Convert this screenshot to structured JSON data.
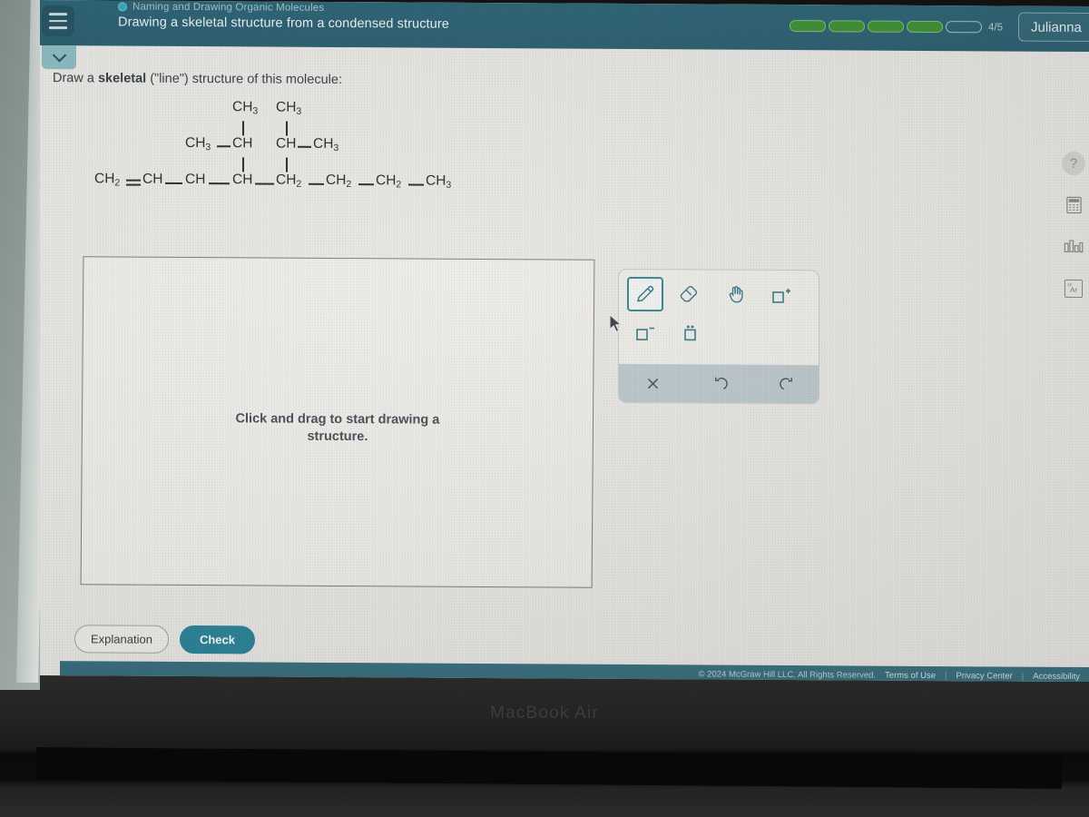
{
  "header": {
    "menu_icon": "hamburger-menu-icon",
    "topic_dot_icon": "status-dot-icon",
    "topic": "Naming and Drawing Organic Molecules",
    "title": "Drawing a skeletal structure from a condensed structure",
    "progress": {
      "segments": 5,
      "filled": 4,
      "count_label": "4/5"
    },
    "user_name": "Julianna",
    "collapse_icon": "chevron-down-icon"
  },
  "question": {
    "prompt_before": "Draw a ",
    "prompt_bold": "skeletal",
    "prompt_after": " (\"line\") structure of this molecule:",
    "molecule": {
      "row_top": [
        "CH3",
        "CH3"
      ],
      "row_mid": [
        "CH3",
        "CH",
        "CH",
        "CH3"
      ],
      "row_main": [
        "CH2",
        "CH",
        "CH",
        "CH",
        "CH2",
        "CH2",
        "CH2",
        "CH3"
      ],
      "condensed_text": "CH2=CH—CH(—CH3 branch with CH3)—CH(—CH3 branch with CH3)—CH2—CH2—CH2—CH3"
    }
  },
  "canvas": {
    "hint_line1": "Click and drag to start drawing a",
    "hint_line2": "structure."
  },
  "toolbar": {
    "tools": [
      {
        "name": "pencil-tool",
        "icon": "pencil-icon",
        "active": true
      },
      {
        "name": "eraser-tool",
        "icon": "eraser-icon",
        "active": false
      },
      {
        "name": "pan-tool",
        "icon": "hand-icon",
        "active": false
      },
      {
        "name": "add-cation-tool",
        "icon": "square-plus-icon",
        "active": false
      },
      {
        "name": "add-anion-tool",
        "icon": "square-minus-icon",
        "active": false
      },
      {
        "name": "lone-pair-tool",
        "icon": "square-lone-pair-icon",
        "active": false
      }
    ],
    "actions": [
      {
        "name": "clear-action",
        "icon": "x-icon",
        "glyph": "×"
      },
      {
        "name": "undo-action",
        "icon": "undo-icon",
        "glyph": "↺"
      },
      {
        "name": "redo-action",
        "icon": "redo-icon",
        "glyph": "↻"
      }
    ]
  },
  "actions": {
    "explanation_label": "Explanation",
    "check_label": "Check"
  },
  "footer": {
    "copyright": "© 2024 McGraw Hill LLC. All Rights Reserved.",
    "terms_label": "Terms of Use",
    "privacy_label": "Privacy Center",
    "accessibility_label": "Accessibility",
    "separator": "|"
  },
  "rail": {
    "items": [
      {
        "name": "help-icon",
        "glyph": "?"
      },
      {
        "name": "calculator-icon",
        "glyph": "⌨"
      },
      {
        "name": "chart-icon",
        "glyph": "▓"
      },
      {
        "name": "periodic-table-icon",
        "symbol": "Ar",
        "number": "18"
      }
    ]
  },
  "device": {
    "brand": "MacBook Air"
  },
  "colors": {
    "header_teal": "#1d5a6d",
    "accent_teal": "#1d7c93",
    "progress_green": "#2f8a27",
    "page_bg": "#e9e8e4"
  }
}
